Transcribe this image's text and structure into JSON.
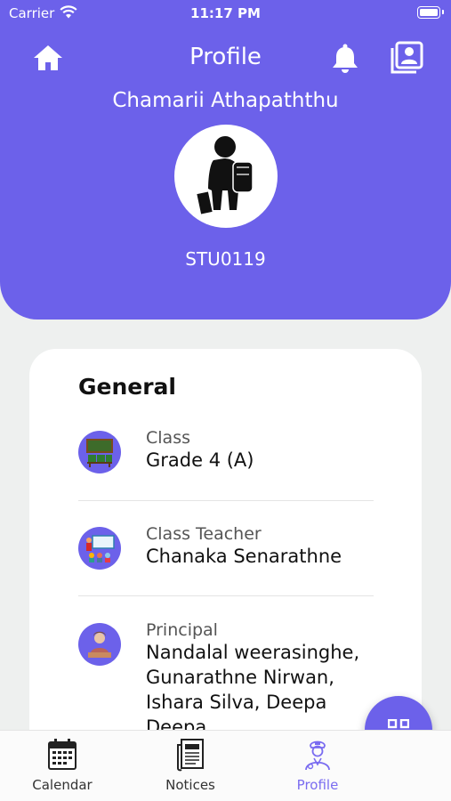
{
  "status_bar": {
    "carrier": "Carrier",
    "time": "11:17 PM"
  },
  "header": {
    "title": "Profile",
    "home_icon": "home-icon",
    "notification_icon": "bell-icon",
    "contacts_icon": "contact-book-icon"
  },
  "student": {
    "name": "Chamarii Athapaththu",
    "id": "STU0119",
    "avatar_icon": "student-with-backpack-icon"
  },
  "general": {
    "title": "General",
    "items": [
      {
        "label": "Class",
        "value": "Grade 4 (A)",
        "icon": "classroom-icon"
      },
      {
        "label": "Class Teacher",
        "value": "Chanaka Senarathne",
        "icon": "teacher-icon"
      },
      {
        "label": "Principal",
        "value": "Nandalal weerasinghe, Gunarathne Nirwan, Ishara Silva, Deepa Deepa",
        "icon": "principal-icon"
      }
    ]
  },
  "fab": {
    "icon": "grid-icon"
  },
  "tabs": [
    {
      "label": "Calendar",
      "icon": "calendar-icon",
      "active": false
    },
    {
      "label": "Notices",
      "icon": "newspaper-icon",
      "active": false
    },
    {
      "label": "Profile",
      "icon": "profile-icon",
      "active": true
    }
  ],
  "colors": {
    "primary": "#6c61ea",
    "background": "#eef0ef",
    "active_tab": "#7a6cf0"
  }
}
